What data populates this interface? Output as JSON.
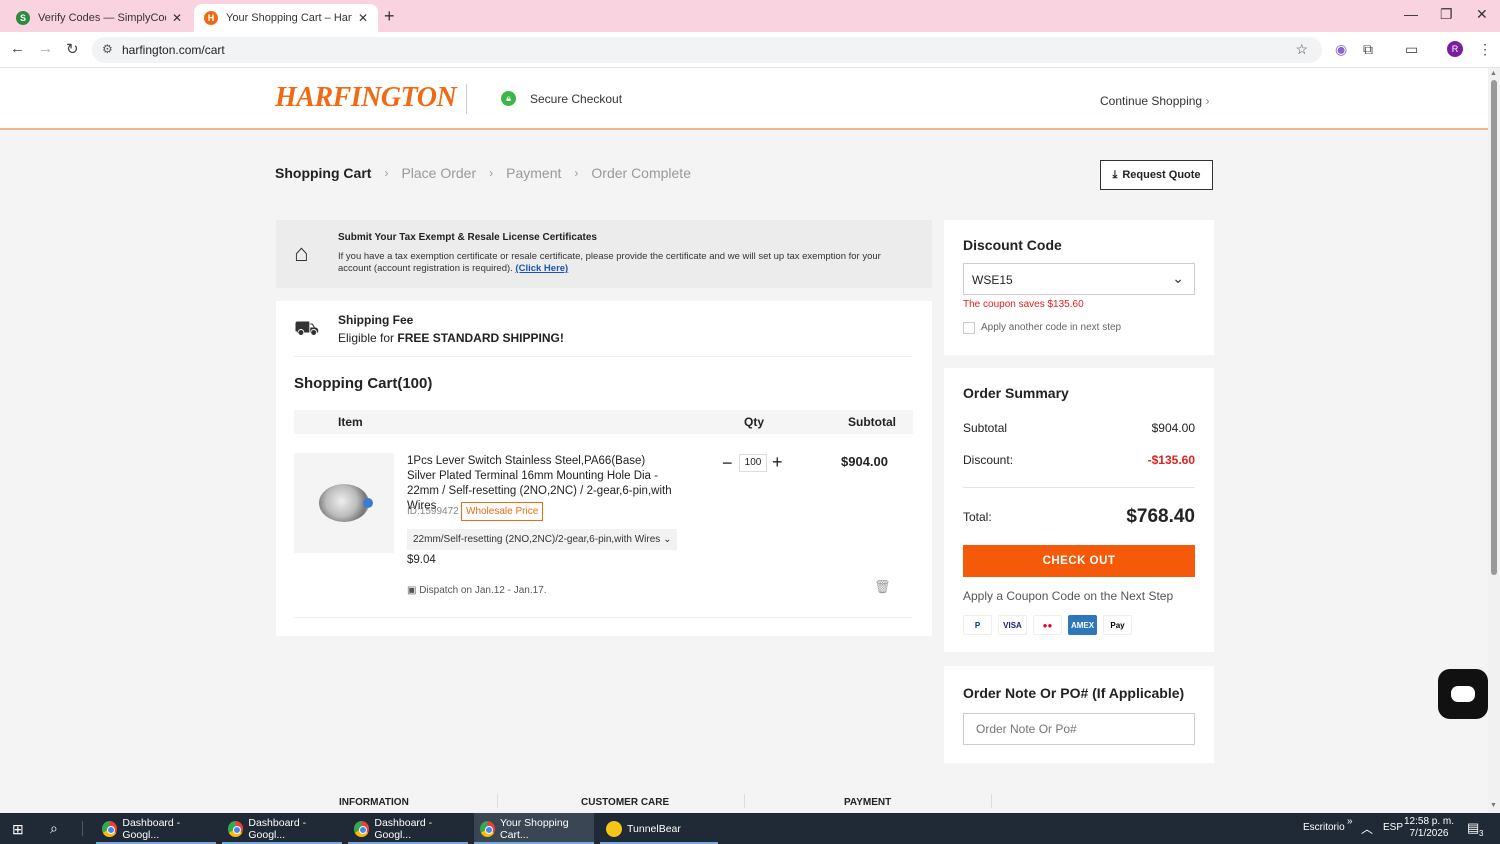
{
  "browser": {
    "tabs": [
      {
        "title": "Verify Codes — SimplyCodes",
        "favicon": "S"
      },
      {
        "title": "Your Shopping Cart – Harfingto",
        "favicon": "H"
      }
    ],
    "url": "harfington.com/cart",
    "new_tab": "+",
    "profile_initial": "R"
  },
  "header": {
    "logo": "HARFINGTON",
    "secure_checkout": "Secure Checkout",
    "continue_shopping": "Continue Shopping"
  },
  "steps": {
    "items": [
      "Shopping Cart",
      "Place Order",
      "Payment",
      "Order Complete"
    ],
    "separator": "›"
  },
  "request_quote": "Request Quote",
  "tax_box": {
    "title": "Submit Your Tax Exempt & Resale License Certificates",
    "text": "If you have a tax exemption certificate or resale certificate, please provide the certificate and we will set up tax exemption for your account (account registration is required).",
    "link": "(Click Here)"
  },
  "shipping": {
    "title": "Shipping Fee",
    "prefix": "Eligible for",
    "highlight": "FREE STANDARD SHIPPING!"
  },
  "cart": {
    "title": "Shopping Cart(100)",
    "columns": {
      "item": "Item",
      "qty": "Qty",
      "subtotal": "Subtotal"
    },
    "item": {
      "name": "1Pcs Lever Switch Stainless Steel,PA66(Base) Silver Plated Terminal 16mm Mounting Hole Dia - 22mm / Self-resetting (2NO,2NC) / 2-gear,6-pin,with Wires",
      "id": "ID:1599472",
      "badge": "Wholesale Price",
      "variant": "22mm/Self-resetting (2NO,2NC)/2-gear,6-pin,with Wires",
      "price": "$9.04",
      "dispatch": "Dispatch on Jan.12 - Jan.17.",
      "qty": "100",
      "subtotal": "$904.00"
    }
  },
  "discount": {
    "title": "Discount Code",
    "code": "WSE15",
    "saves": "The coupon saves $135.60",
    "another": "Apply another code in next step"
  },
  "summary": {
    "title": "Order Summary",
    "subtotal_label": "Subtotal",
    "subtotal_value": "$904.00",
    "discount_label": "Discount:",
    "discount_value": "-$135.60",
    "total_label": "Total:",
    "total_value": "$768.40",
    "checkout": "CHECK OUT",
    "coupon_next": "Apply a Coupon Code on the Next Step",
    "payment_methods": [
      "P",
      "VISA",
      "●●",
      "AMEX",
      "Pay"
    ]
  },
  "note": {
    "title": "Order Note Or PO# (If Applicable)",
    "placeholder": "Order Note Or Po#"
  },
  "footer": {
    "columns": [
      "INFORMATION",
      "CUSTOMER CARE",
      "PAYMENT"
    ]
  },
  "taskbar": {
    "apps": [
      "Dashboard - Googl...",
      "Dashboard - Googl...",
      "Dashboard - Googl...",
      "Your Shopping Cart...",
      "TunnelBear"
    ],
    "desktop": "Escritorio",
    "language": "ESP",
    "time": "12:58 p. m.",
    "date": "7/1/2026",
    "notifications": "3"
  },
  "colors": {
    "brand": "#f06a14",
    "checkout": "#f55a0a",
    "discount": "#e02020"
  }
}
